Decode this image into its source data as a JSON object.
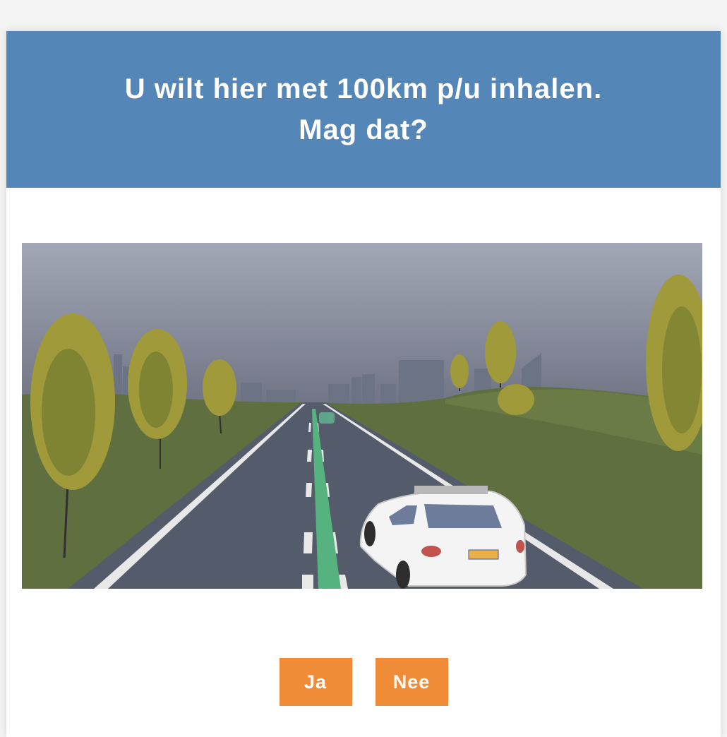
{
  "question": {
    "text": "U wilt hier met 100km p/u inhalen.\nMag dat?"
  },
  "scene": {
    "description_icon": "road-overtaking-scene"
  },
  "answers": {
    "yes_label": "Ja",
    "no_label": "Nee"
  },
  "colors": {
    "header": "#5486b7",
    "button": "#f08c37",
    "green_lane_marking": "#56b27f"
  }
}
